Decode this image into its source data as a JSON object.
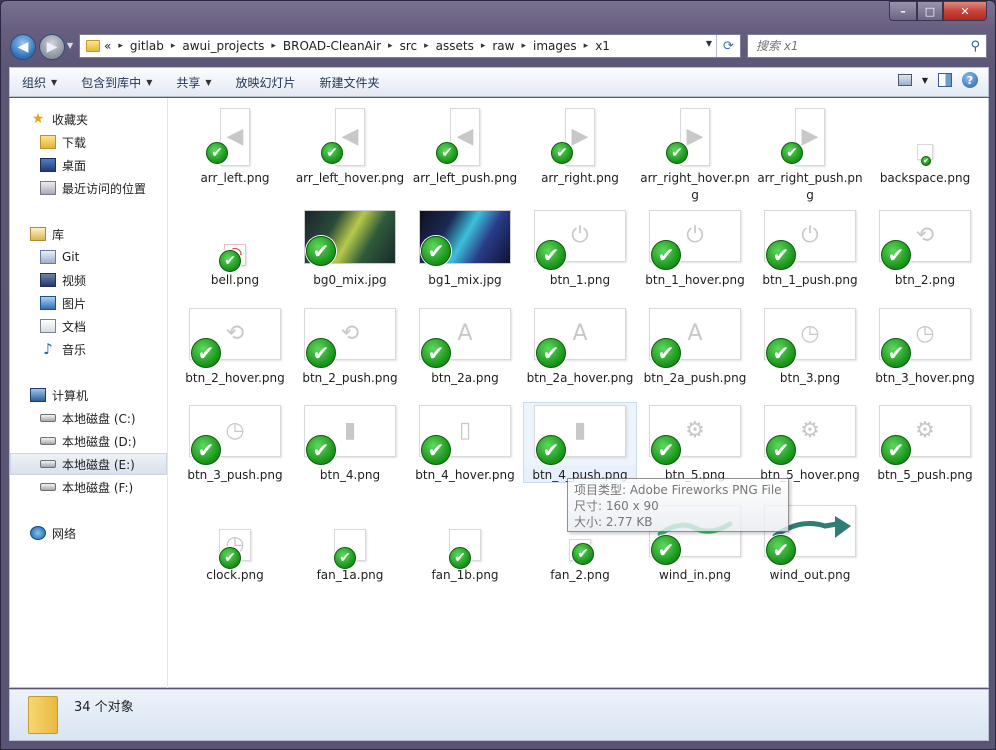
{
  "window": {
    "min_icon": "minimize-icon",
    "max_icon": "maximize-icon",
    "close_icon": "close-icon",
    "min": "–",
    "max": "□",
    "close": "✕"
  },
  "nav": {
    "back": "◀",
    "forward": "▶",
    "dropdown": "▼"
  },
  "address": {
    "crumbs": [
      "«",
      "gitlab",
      "awui_projects",
      "BROAD-CleanAir",
      "src",
      "assets",
      "raw",
      "images",
      "x1"
    ],
    "separator": "▸"
  },
  "search": {
    "placeholder": "搜索 x1"
  },
  "toolbar": {
    "organize": "组织",
    "include": "包含到库中",
    "share": "共享",
    "slideshow": "放映幻灯片",
    "new_folder": "新建文件夹"
  },
  "sidebar": {
    "favorites": "收藏夹",
    "downloads": "下载",
    "desktop": "桌面",
    "recent": "最近访问的位置",
    "libraries": "库",
    "git": "Git",
    "video": "视频",
    "pictures": "图片",
    "documents": "文档",
    "music": "音乐",
    "computer": "计算机",
    "drive_c": "本地磁盘 (C:)",
    "drive_d": "本地磁盘 (D:)",
    "drive_e": "本地磁盘 (E:)",
    "drive_f": "本地磁盘 (F:)",
    "network": "网络"
  },
  "files": [
    "arr_left.png",
    "arr_left_hover.png",
    "arr_left_push.png",
    "arr_right.png",
    "arr_right_hover.png",
    "arr_right_push.png",
    "backspace.png",
    "bell.png",
    "bg0_mix.jpg",
    "bg1_mix.jpg",
    "btn_1.png",
    "btn_1_hover.png",
    "btn_1_push.png",
    "btn_2.png",
    "btn_2_hover.png",
    "btn_2_push.png",
    "btn_2a.png",
    "btn_2a_hover.png",
    "btn_2a_push.png",
    "btn_3.png",
    "btn_3_hover.png",
    "btn_3_push.png",
    "btn_4.png",
    "btn_4_hover.png",
    "btn_4_push.png",
    "btn_5.png",
    "btn_5_hover.png",
    "btn_5_push.png",
    "clock.png",
    "fan_1a.png",
    "fan_1b.png",
    "fan_2.png",
    "wind_in.png",
    "wind_out.png"
  ],
  "tooltip": {
    "line1": "项目类型: Adobe Fireworks PNG File",
    "line2": "尺寸: 160 x 90",
    "line3": "大小: 2.77 KB"
  },
  "status": {
    "count": "34 个对象"
  },
  "colors": {
    "accent": "#1f5fa8",
    "check": "#1c951c",
    "wind_in": "#3dbb6a",
    "wind_out": "#2f7d75"
  }
}
